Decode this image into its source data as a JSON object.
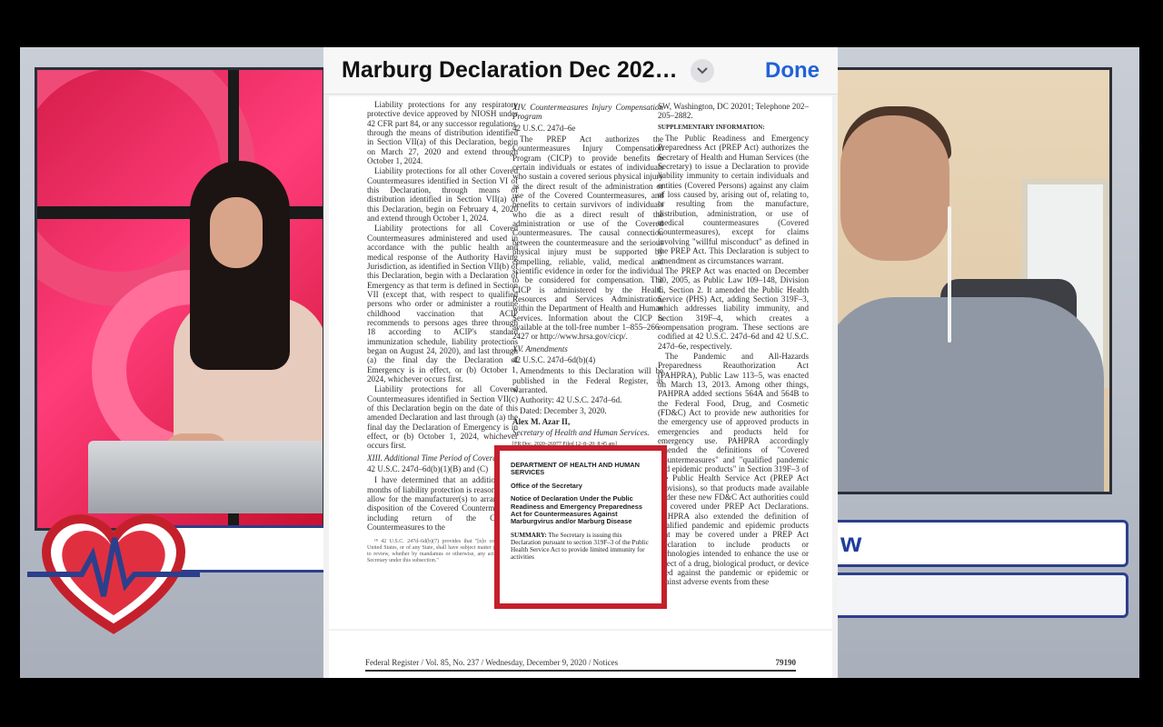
{
  "viewer": {
    "title": "Marburg Declaration Dec 202…",
    "done_label": "Done"
  },
  "lower_third_right_fragment": "w",
  "document": {
    "col1": [
      "Liability protections for any respiratory protective device approved by NIOSH under 42 CFR part 84, or any successor regulations, through the means of distribution identified in Section VII(a) of this Declaration, begin on March 27, 2020 and extend through October 1, 2024.",
      "Liability protections for all other Covered Countermeasures identified in Section VI of this Declaration, through means of distribution identified in Section VII(a) of this Declaration, begin on February 4, 2020 and extend through October 1, 2024.",
      "Liability protections for all Covered Countermeasures administered and used in accordance with the public health and medical response of the Authority Having Jurisdiction, as identified in Section VII(b) of this Declaration, begin with a Declaration of Emergency as that term is defined in Section VII (except that, with respect to qualified persons who order or administer a routine childhood vaccination that ACIP recommends to persons ages three through 18 according to ACIP's standard immunization schedule, liability protections began on August 24, 2020), and last through (a) the final day the Declaration of Emergency is in effect, or (b) October 1, 2024, whichever occurs first.",
      "Liability protections for all Covered Countermeasures identified in Section VII(c) of this Declaration begin on the date of this amended Declaration and last through (a) the final day the Declaration of Emergency is in effect, or (b) October 1, 2024, whichever occurs first."
    ],
    "col1_heading": "XIII. Additional Time Period of Coverage",
    "col1_cite": "42 U.S.C. 247d–6d(b)(1)(B) and (C)",
    "col1_after": "I have determined that an additional 12 months of liability protection is reasonable to allow for the manufacturer(s) to arrange for disposition of the Covered Countermeasure, including return of the Covered Countermeasures to the",
    "col1_footnote": "¹⁸ 42 U.S.C. 247d–6d(b)(7) provides that \"[n]o court of the United States, or of any State, shall have subject matter jurisdiction to review, whether by mandamus or otherwise, any action by the Secretary under this subsection.\"",
    "col2_heading": "XIV. Countermeasures Injury Compensation Program",
    "col2_cite": "42 U.S.C. 247d–6e",
    "col2_text": "The PREP Act authorizes the Countermeasures Injury Compensation Program (CICP) to provide benefits to certain individuals or estates of individuals who sustain a covered serious physical injury as the direct result of the administration or use of the Covered Countermeasures, and benefits to certain survivors of individuals who die as a direct result of the administration or use of the Covered Countermeasures. The causal connection between the countermeasure and the serious physical injury must be supported by compelling, reliable, valid, medical and scientific evidence in order for the individual to be considered for compensation. The CICP is administered by the Health Resources and Services Administration, within the Department of Health and Human Services. Information about the CICP is available at the toll-free number 1–855–266–2427 or http://www.hrsa.gov/cicp/.",
    "col2_heading2": "XV. Amendments",
    "col2_cite2": "42 U.S.C. 247d–6d(b)(4)",
    "col2_text2": "Amendments to this Declaration will be published in the Federal Register, as warranted.",
    "col2_authority": "Authority: 42 U.S.C. 247d–6d.",
    "col2_dated": "Dated: December 3, 2020.",
    "col2_sign": "Alex M. Azar II,",
    "col2_role": "Secretary of Health and Human Services.",
    "col2_frdoc": "[FR Doc. 2020–26977 Filed 12–8–20; 8:45 am]",
    "col3_text0": "SW, Washington, DC 20201; Telephone 202–205–2882.",
    "col3_supp_head": "SUPPLEMENTARY INFORMATION:",
    "col3_text1": "The Public Readiness and Emergency Preparedness Act (PREP Act) authorizes the Secretary of Health and Human Services (the Secretary) to issue a Declaration to provide liability immunity to certain individuals and entities (Covered Persons) against any claim of loss caused by, arising out of, relating to, or resulting from the manufacture, distribution, administration, or use of medical countermeasures (Covered Countermeasures), except for claims involving \"willful misconduct\" as defined in the PREP Act. This Declaration is subject to amendment as circumstances warrant.",
    "col3_text2": "The PREP Act was enacted on December 30, 2005, as Public Law 109–148, Division C, Section 2. It amended the Public Health Service (PHS) Act, adding Section 319F–3, which addresses liability immunity, and Section 319F–4, which creates a compensation program. These sections are codified at 42 U.S.C. 247d–6d and 42 U.S.C. 247d–6e, respectively.",
    "col3_text3": "The Pandemic and All-Hazards Preparedness Reauthorization Act (PAHPRA), Public Law 113–5, was enacted on March 13, 2013. Among other things, PAHPRA added sections 564A and 564B to the Federal Food, Drug, and Cosmetic (FD&C) Act to provide new authorities for the emergency use of approved products in emergencies and products held for emergency use. PAHPRA accordingly amended the definitions of \"Covered Countermeasures\" and \"qualified pandemic and epidemic products\" in Section 319F–3 of the Public Health Service Act (PREP Act provisions), so that products made available under these new FD&C Act authorities could be covered under PREP Act Declarations. PAHPRA also extended the definition of qualified pandemic and epidemic products that may be covered under a PREP Act Declaration to include products or technologies intended to enhance the use or effect of a drug, biological product, or device used against the pandemic or epidemic or against adverse events from these",
    "box_dept": "DEPARTMENT OF HEALTH AND HUMAN SERVICES",
    "box_office": "Office of the Secretary",
    "box_notice": "Notice of Declaration Under the Public Readiness and Emergency Preparedness Act for Countermeasures Against Marburgvirus and/or Marburg Disease",
    "box_summary_head": "SUMMARY:",
    "box_summary": "The Secretary is issuing this Declaration pursuant to section 319F–3 of the Public Health Service Act to provide limited immunity for activities",
    "footer_left": "Federal Register / Vol. 85, No. 237 / Wednesday, December 9, 2020 / Notices",
    "footer_page": "79190"
  },
  "colors": {
    "highlight": "#c4202c",
    "done": "#2162d8",
    "bar_border": "#2c3f8c"
  }
}
